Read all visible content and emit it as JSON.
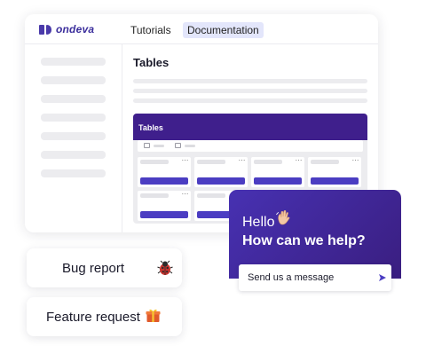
{
  "app": {
    "logo_text": "ondeva",
    "nav": [
      "Tutorials",
      "Documentation"
    ],
    "active_nav": "Documentation",
    "page_title": "Tables",
    "tables_panel": {
      "header_title": "Tables",
      "card_menu_glyph": "⋯",
      "cards_count": 8
    }
  },
  "chat": {
    "greeting": "Hello",
    "greeting_icon": "waving-hand-icon",
    "heading": "How can we help?",
    "message_placeholder": "Send us a message",
    "send_icon": "send-arrow-icon"
  },
  "actions": {
    "bug_report": {
      "label": "Bug report",
      "icon": "ladybug-icon"
    },
    "feature_request": {
      "label": "Feature request",
      "icon": "gift-icon"
    }
  },
  "colors": {
    "brand": "#3b2e9c",
    "accent": "#4b3dc2",
    "chat_gradient_start": "#4731b2",
    "chat_gradient_end": "#3a1e80",
    "panel_header": "#3f1f8c",
    "nav_active_bg": "#e3e6fb"
  }
}
